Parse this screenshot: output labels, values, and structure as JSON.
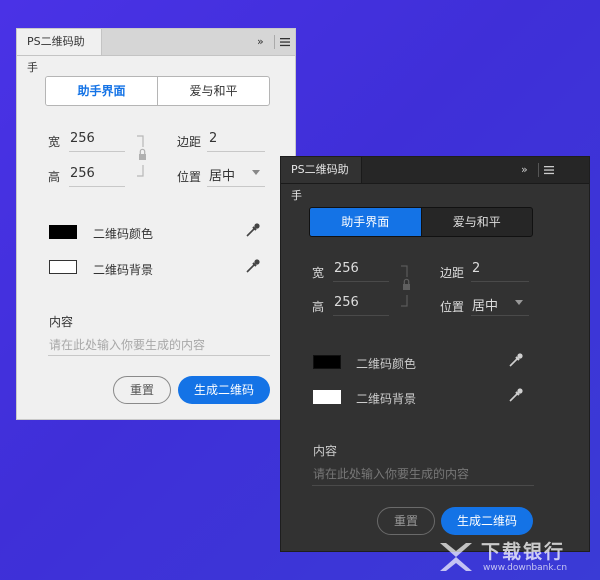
{
  "panel_title": "PS二维码助手",
  "collapse_glyph": "»",
  "tabs": {
    "helper": "助手界面",
    "love": "爱与和平"
  },
  "fields": {
    "width_label": "宽",
    "width_value": "256",
    "height_label": "高",
    "height_value": "256",
    "margin_label": "边距",
    "margin_value": "2",
    "position_label": "位置",
    "position_value": "居中"
  },
  "colors": {
    "qr_color_label": "二维码颜色",
    "qr_bg_label": "二维码背景",
    "accent": "#1473e6"
  },
  "content": {
    "label": "内容",
    "placeholder": "请在此处输入你要生成的内容"
  },
  "buttons": {
    "reset": "重置",
    "generate": "生成二维码"
  },
  "watermark": {
    "brand": "下载银行",
    "url": "www.downbank.cn"
  }
}
